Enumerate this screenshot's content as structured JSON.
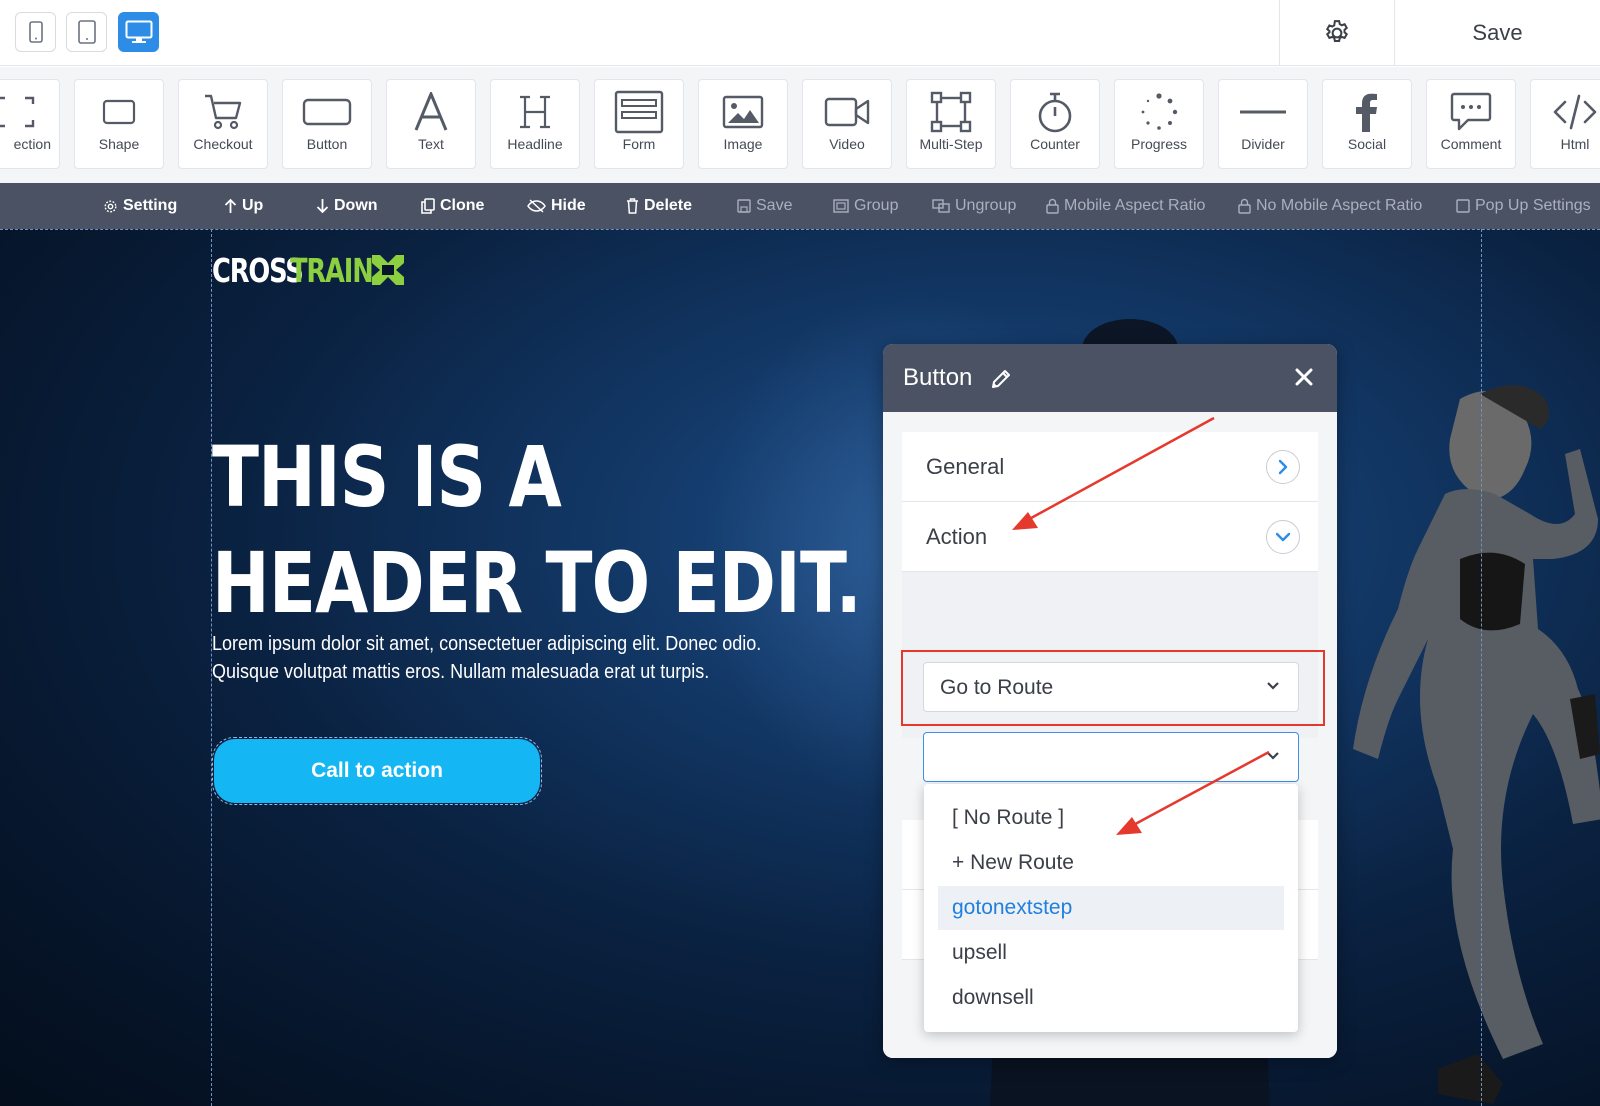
{
  "topbar": {
    "devices": [
      "mobile",
      "tablet",
      "desktop"
    ],
    "active_device": "desktop",
    "save_label": "Save"
  },
  "elements": [
    {
      "label": "ection",
      "icon": "section-icon"
    },
    {
      "label": "Shape",
      "icon": "shape-icon"
    },
    {
      "label": "Checkout",
      "icon": "cart-icon"
    },
    {
      "label": "Button",
      "icon": "button-icon"
    },
    {
      "label": "Text",
      "icon": "text-icon"
    },
    {
      "label": "Headline",
      "icon": "headline-icon"
    },
    {
      "label": "Form",
      "icon": "form-icon"
    },
    {
      "label": "Image",
      "icon": "image-icon"
    },
    {
      "label": "Video",
      "icon": "video-icon"
    },
    {
      "label": "Multi-Step",
      "icon": "multistep-icon"
    },
    {
      "label": "Counter",
      "icon": "stopwatch-icon"
    },
    {
      "label": "Progress",
      "icon": "progress-icon"
    },
    {
      "label": "Divider",
      "icon": "divider-icon"
    },
    {
      "label": "Social",
      "icon": "facebook-icon"
    },
    {
      "label": "Comment",
      "icon": "comment-icon"
    },
    {
      "label": "Html",
      "icon": "code-icon"
    }
  ],
  "actions": [
    {
      "label": "Setting",
      "enabled": true
    },
    {
      "label": "Up",
      "enabled": true
    },
    {
      "label": "Down",
      "enabled": true
    },
    {
      "label": "Clone",
      "enabled": true
    },
    {
      "label": "Hide",
      "enabled": true
    },
    {
      "label": "Delete",
      "enabled": true
    },
    {
      "label": "Save",
      "enabled": false
    },
    {
      "label": "Group",
      "enabled": false
    },
    {
      "label": "Ungroup",
      "enabled": false
    },
    {
      "label": "Mobile Aspect Ratio",
      "enabled": false
    },
    {
      "label": "No Mobile Aspect Ratio",
      "enabled": false
    },
    {
      "label": "Pop Up Settings",
      "enabled": false
    }
  ],
  "canvas": {
    "logo_white": "CROSS",
    "logo_green": "TRAIN",
    "headline_line1": "THIS IS A",
    "headline_line2": "HEADER TO EDIT.",
    "subtext": "Lorem ipsum dolor sit amet, consectetuer adipiscing elit. Donec odio. Quisque volutpat mattis eros. Nullam malesuada erat ut turpis.",
    "cta_label": "Call to action"
  },
  "panel": {
    "title": "Button",
    "sections": [
      {
        "label": "General",
        "state": "collapsed"
      },
      {
        "label": "Action",
        "state": "expanded"
      }
    ],
    "action_select_value": "Go to Route",
    "route_select_value": "",
    "route_options": [
      "[ No Route ]",
      "+ New Route",
      "gotonextstep",
      "upsell",
      "downsell"
    ],
    "route_highlighted": "gotonextstep"
  },
  "colors": {
    "accent": "#2d8de6",
    "cta": "#14b6f4",
    "logo_green": "#8ccf3f",
    "annotation_red": "#e5392e",
    "panel_header": "#4a5263"
  }
}
